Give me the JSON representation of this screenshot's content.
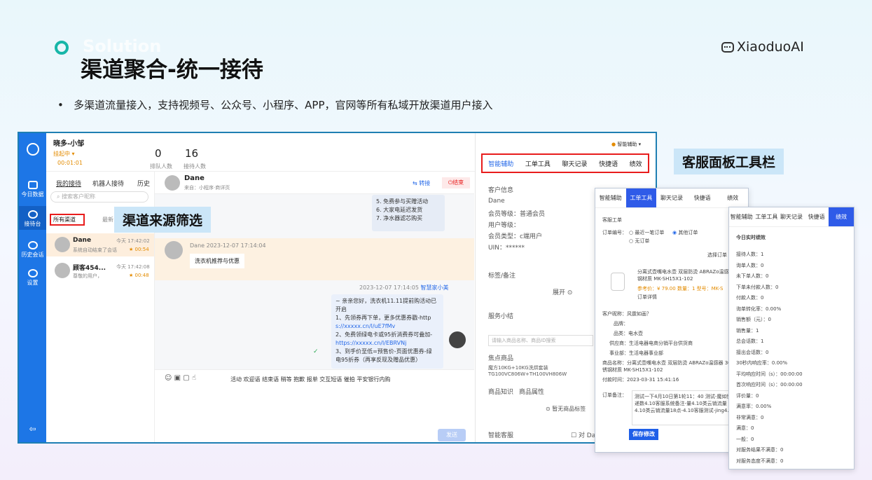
{
  "header": {
    "ghost": "Solution",
    "title": "渠道聚合-统一接待",
    "brand": "XiaoduoAI",
    "bullet": "多渠道流量接入，支持视频号、公众号、小程序、APP，官网等所有私域开放渠道用户接入"
  },
  "callouts": {
    "toolbar": "客服面板工具栏",
    "filter": "渠道来源筛选"
  },
  "nav": {
    "items": [
      "今日数据",
      "接待台",
      "历史会话",
      "设置"
    ]
  },
  "topbar": {
    "shop": "晓多-小邹",
    "status": "挂起中 ▾",
    "timer": "00:01:01",
    "queue_n": "0",
    "queue_label": "排队人数",
    "recv_n": "16",
    "recv_label": "接待人数"
  },
  "list": {
    "tabs": [
      "我的接待",
      "机器人接待",
      "历史"
    ],
    "search_placeholder": "搜索客户昵称",
    "filter": "所有渠道",
    "filter2": "最新",
    "conversations": [
      {
        "name": "Dane",
        "time": "今天 17:42:02",
        "msg": "系统自动结束了会话",
        "score": "00:54"
      },
      {
        "name": "顾客454...",
        "time": "今天 17:42:08",
        "msg": "尊敬的用户，",
        "score": "00:48"
      }
    ]
  },
  "chat": {
    "name": "Dane",
    "from": "来自：小程序·商详页",
    "transfer": "转接",
    "end": "结束",
    "top_lines": [
      "5. 免费参与买赠活动",
      "6. 大家电延迟发货",
      "7. 净水器滤芯购买"
    ],
    "msg_meta": "Dane 2023-12-07 17:14:04",
    "msg_text": "洗衣机推荐与优惠",
    "reply_meta": "2023-12-07 17:14:05",
    "reply_agent": "智慧家小美",
    "reply_lines": [
      "~ 亲亲您好，洗衣机11.11提前购活动已开启",
      "1、先领券再下单，更多优惠券戳-http",
      "s://xxxxx.cn/l/uE7fMv",
      "2、免费领绿电卡或95折消费券可叠加-",
      "https://xxxxx.cn/l/EBRVNj",
      "3、到手价至低=预售价-页面优惠券-绿",
      "电95折券（再享反现及赠品优惠）"
    ],
    "toolbar": "活动  欢迎语  结束语  稍等  抱歉  报单  交互短语  催拍  平安银行内购",
    "send": "发送"
  },
  "right": {
    "assist": "智能辅助 ▾",
    "tabs": [
      "智能辅助",
      "工单工具",
      "聊天记录",
      "快捷语",
      "绩效"
    ],
    "info_title": "客户信息",
    "fields": [
      "Dane",
      "会员等级：普通会员",
      "用户等级：",
      "会员类型：c端用户",
      "UIN：******"
    ],
    "labels": "标签/备注",
    "expand": "展开 ⊙",
    "service": "服务小结",
    "goods_ph": "请输入商品名称、商品ID搜索",
    "focus": "焦点商品",
    "goods": "魔方10KG+10KG洗烘套装 TG100VC806W+TH100VH806W",
    "kb": "商品知识",
    "attr": "商品属性",
    "nolabel": "⊙ 暂无商品标签",
    "smart": "智能客服",
    "check": "对 Da"
  },
  "panel1": {
    "tabs": [
      "智能辅助",
      "工单工具",
      "聊天记录",
      "快捷语",
      "绩效"
    ],
    "title": "客服工单",
    "orders_label": "订单编号：",
    "opt1": "最近一笔订单",
    "opt2": "其他订单",
    "opt3": "无订单",
    "pick": "选择订单",
    "prod": "分离式壶嘴电水壶 双层防烫 ABRAZo温感器 304钢材质 MK-SH15X1-102",
    "price": "参考价：¥ 79.00  数量：1  型号：MK-S",
    "detail": "订单详情",
    "nick": "客户昵称：风霆如画？",
    "brand": "品牌：",
    "cat": "品类：电水壶",
    "supplier": "供应商：生活电器电商分销平台供货商",
    "dept": "事业部：生活电器事业部",
    "pname": "商品名称：分离式壶嘴电水壶 双层防烫 ABRAZo温感器 304不锈钢材质 MK-SH15X1-102",
    "paid": "付款时间：2023-03-31 15:41:16",
    "note_label": "订单备注：",
    "note": "测试一下4月10日第1轮11：40 测试-魔如快递数4.10客服系统备注-量4.10类云销流量4.10类云销流量18点-4.10客服测试-jing4.14",
    "save": "保存修改"
  },
  "panel2": {
    "tabs": [
      "智能辅助",
      "工单工具",
      "聊天记录",
      "快捷语",
      "绩效"
    ],
    "title": "今日实时绩效",
    "rows": [
      "接待人数：1",
      "询单人数：0",
      "未下单人数：0",
      "下单未付款人数：0",
      "付款人数：0",
      "询单转化率：0.00%",
      "销售额（元）：0",
      "销售量：1",
      "总会话数：1",
      "接出会话数：0",
      "30秒内响应率：0.00%",
      "平均响应时间（s）：00:00:00",
      "首次响应时间（s）：00:00:00",
      "评价量：0",
      "满意率：0.00%",
      "非常满意：0",
      "满意：0",
      "一般：0",
      "对服务结果不满意：0",
      "对服务态度不满意：0"
    ]
  }
}
